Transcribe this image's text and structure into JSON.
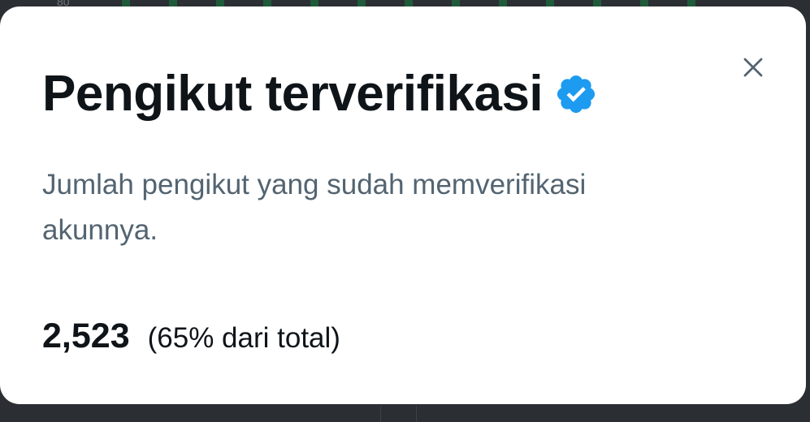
{
  "background": {
    "axis_tick": "80"
  },
  "modal": {
    "title": "Pengikut terverifikasi",
    "verified_badge_icon": "verified-badge-icon",
    "description": "Jumlah pengikut yang sudah memverifikasi akunnya.",
    "close_icon": "close-icon",
    "count": "2,523",
    "percentage_text": "(65% dari total)"
  },
  "colors": {
    "title": "#0f1419",
    "description": "#536471",
    "verified_blue": "#1d9bf0",
    "close": "#536471",
    "backdrop": "#2b2f33"
  }
}
